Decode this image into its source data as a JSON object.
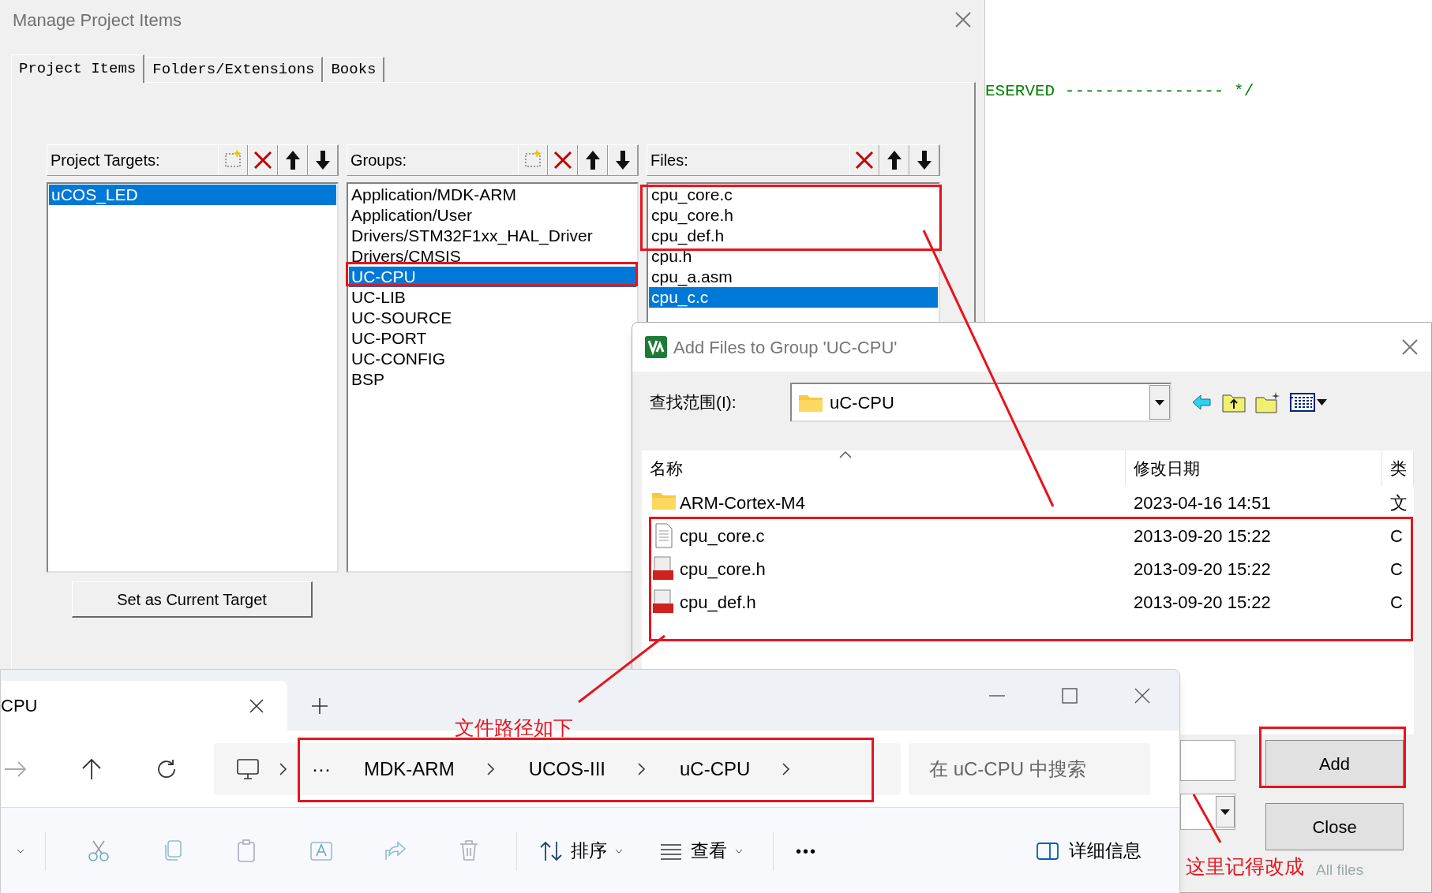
{
  "editor": {
    "code_line": "ESERVED ---------------- */"
  },
  "manage_window": {
    "title": "Manage Project Items",
    "tabs": [
      {
        "label": "Project Items",
        "selected": true
      },
      {
        "label": "Folders/Extensions",
        "selected": false
      },
      {
        "label": "Books",
        "selected": false
      }
    ],
    "panels": [
      {
        "header": "Project Targets:",
        "tools": [
          {
            "kind": "new"
          },
          {
            "kind": "delete"
          },
          {
            "kind": "up"
          },
          {
            "kind": "down"
          }
        ],
        "items": [
          {
            "label": "uCOS_LED",
            "selected": true
          }
        ]
      },
      {
        "header": "Groups:",
        "tools": [
          {
            "kind": "new"
          },
          {
            "kind": "delete"
          },
          {
            "kind": "up"
          },
          {
            "kind": "down"
          }
        ],
        "items": [
          {
            "label": "Application/MDK-ARM",
            "selected": false
          },
          {
            "label": "Application/User",
            "selected": false
          },
          {
            "label": "Drivers/STM32F1xx_HAL_Driver",
            "selected": false
          },
          {
            "label": "Drivers/CMSIS",
            "selected": false
          },
          {
            "label": "UC-CPU",
            "selected": true
          },
          {
            "label": "UC-LIB",
            "selected": false
          },
          {
            "label": "UC-SOURCE",
            "selected": false
          },
          {
            "label": "UC-PORT",
            "selected": false
          },
          {
            "label": "UC-CONFIG",
            "selected": false
          },
          {
            "label": "BSP",
            "selected": false
          }
        ]
      },
      {
        "header": "Files:",
        "tools": [
          {
            "kind": "delete"
          },
          {
            "kind": "up"
          },
          {
            "kind": "down"
          }
        ],
        "items": [
          {
            "label": "cpu_core.c",
            "selected": false
          },
          {
            "label": "cpu_core.h",
            "selected": false
          },
          {
            "label": "cpu_def.h",
            "selected": false
          },
          {
            "label": "cpu.h",
            "selected": false
          },
          {
            "label": "cpu_a.asm",
            "selected": false
          },
          {
            "label": "cpu_c.c",
            "selected": true
          }
        ]
      }
    ],
    "set_target_button": "Set as Current Target"
  },
  "add_dialog": {
    "title": "Add Files to Group 'UC-CPU'",
    "look_in_label": "查找范围(I):",
    "look_in_value": "uC-CPU",
    "columns": [
      "名称",
      "修改日期",
      "类"
    ],
    "rows": [
      {
        "kind": "folder",
        "name": "ARM-Cortex-M4",
        "date": "2023-04-16 14:51",
        "type": "文"
      },
      {
        "kind": "text",
        "name": "cpu_core.c",
        "date": "2013-09-20 15:22",
        "type": "C"
      },
      {
        "kind": "header",
        "name": "cpu_core.h",
        "date": "2013-09-20 15:22",
        "type": "C"
      },
      {
        "kind": "header",
        "name": "cpu_def.h",
        "date": "2013-09-20 15:22",
        "type": "C"
      }
    ],
    "add_button": "Add",
    "close_button": "Close",
    "file_type_value": "All files"
  },
  "explorer": {
    "tab": "CPU",
    "path": [
      "···",
      "MDK-ARM",
      "UCOS-III",
      "uC-CPU"
    ],
    "search_placeholder": "在 uC-CPU 中搜索",
    "toolbar": [
      {
        "kind": "new"
      },
      {
        "kind": "cut"
      },
      {
        "kind": "copy"
      },
      {
        "kind": "paste"
      },
      {
        "kind": "rename"
      },
      {
        "kind": "share"
      },
      {
        "kind": "delete"
      },
      {
        "kind": "sort",
        "label": "排序"
      },
      {
        "kind": "view",
        "label": "查看"
      },
      {
        "kind": "more",
        "label": "•••"
      },
      {
        "kind": "details",
        "label": "详细信息"
      }
    ]
  },
  "annotations": [
    {
      "text": "文件路径如下"
    },
    {
      "text": "这里记得改成"
    }
  ]
}
